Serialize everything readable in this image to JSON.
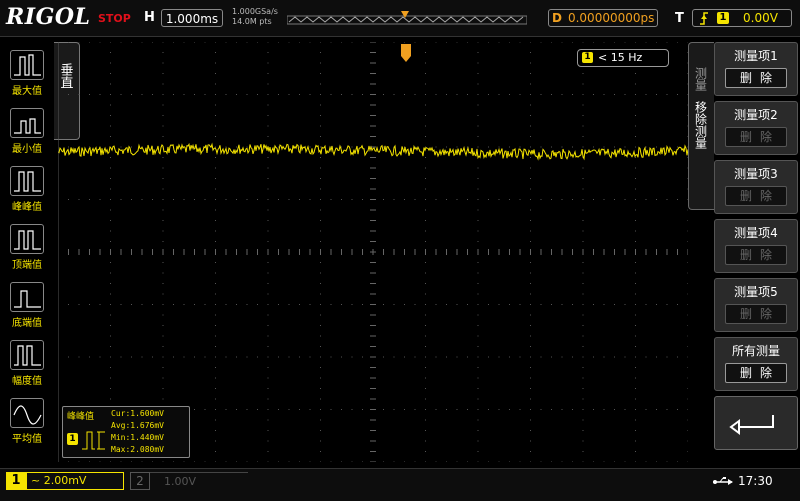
{
  "brand": "RIGOL",
  "status": "STOP",
  "top": {
    "h_label": "H",
    "timebase": "1.000ms",
    "sample_rate": "1.000GSa/s",
    "mem_depth": "14.0M pts",
    "trigger_pos_label": "D",
    "trigger_pos": "0.00000000ps",
    "trigger_label": "T",
    "trigger_level": "0.00V",
    "trigger_channel": "1"
  },
  "left_menu": {
    "vertical_tab": "垂直",
    "items": [
      {
        "label": "最大值",
        "icon": "max-value-icon"
      },
      {
        "label": "最小值",
        "icon": "min-value-icon"
      },
      {
        "label": "峰峰值",
        "icon": "peak-peak-icon"
      },
      {
        "label": "顶端值",
        "icon": "top-value-icon"
      },
      {
        "label": "底端值",
        "icon": "base-value-icon"
      },
      {
        "label": "幅度值",
        "icon": "amplitude-icon"
      },
      {
        "label": "平均值",
        "icon": "average-icon"
      }
    ]
  },
  "freq_badge": {
    "channel": "1",
    "text": "< 15 Hz"
  },
  "right_menu": {
    "side_tab_top": "测量",
    "side_tab_bottom": "移除测量",
    "items": [
      {
        "title": "测量项1",
        "button": "删除",
        "enabled": true
      },
      {
        "title": "测量项2",
        "button": "删除",
        "enabled": false
      },
      {
        "title": "测量项3",
        "button": "删除",
        "enabled": false
      },
      {
        "title": "测量项4",
        "button": "删除",
        "enabled": false
      },
      {
        "title": "测量项5",
        "button": "删除",
        "enabled": false
      },
      {
        "title": "所有测量",
        "button": "删除",
        "enabled": true
      }
    ],
    "back_icon": "return-arrow-icon"
  },
  "measurement": {
    "title": "峰峰值",
    "channel": "1",
    "cur": "Cur:1.600mV",
    "avg": "Avg:1.676mV",
    "min": "Min:1.440mV",
    "max": "Max:2.080mV"
  },
  "bottom": {
    "ch1_num": "1",
    "ch1_scale": "~ 2.00mV",
    "ch2_num": "2",
    "ch2_scale": "1.00V",
    "usb_icon": "usb-icon",
    "time": "17:30"
  },
  "colors": {
    "ch1": "#f5e400",
    "trigger": "#f0a020",
    "stop": "#e0101a"
  }
}
